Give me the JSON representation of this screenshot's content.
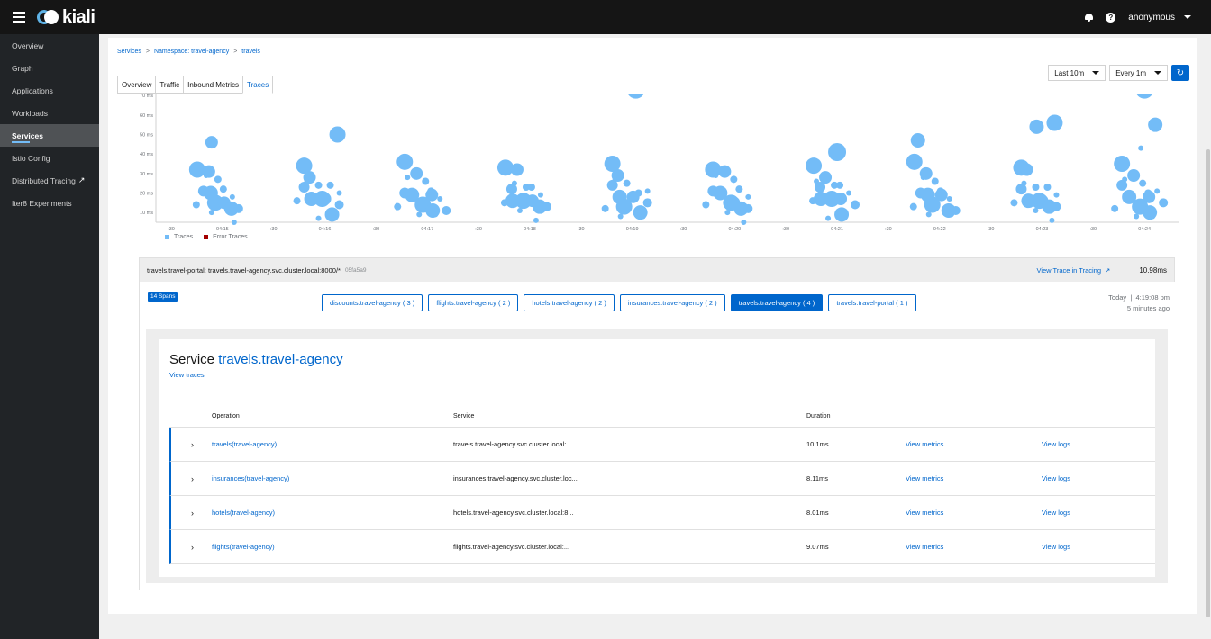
{
  "header": {
    "brand": "kiali",
    "user": "anonymous"
  },
  "sidebar": {
    "items": [
      {
        "label": "Overview"
      },
      {
        "label": "Graph"
      },
      {
        "label": "Applications"
      },
      {
        "label": "Workloads"
      },
      {
        "label": "Services",
        "active": true
      },
      {
        "label": "Istio Config"
      },
      {
        "label": "Distributed Tracing"
      },
      {
        "label": "Iter8 Experiments"
      }
    ]
  },
  "breadcrumb": {
    "services": "Services",
    "namespace": "Namespace: travel-agency",
    "service": "travels"
  },
  "time_controls": {
    "duration": "Last 10m",
    "refresh": "Every 1m"
  },
  "tabs": [
    "Overview",
    "Traffic",
    "Inbound Metrics",
    "Traces"
  ],
  "chart_data": {
    "type": "scatter",
    "y_ticks": [
      "70 ms",
      "60 ms",
      "50 ms",
      "40 ms",
      "30 ms",
      "20 ms",
      "10 ms"
    ],
    "ylim": [
      5,
      71
    ],
    "x_ticks": [
      ":30",
      "04:15",
      ":30",
      "04:16",
      ":30",
      "04:17",
      ":30",
      "04:18",
      ":30",
      "04:19",
      ":30",
      "04:20",
      ":30",
      "04:21",
      ":30",
      "04:22",
      ":30",
      "04:23",
      ":30",
      "04:24"
    ],
    "legend": [
      {
        "name": "Traces",
        "color": "#73bcf7"
      },
      {
        "name": "Error Traces",
        "color": "#a30000"
      }
    ]
  },
  "trace": {
    "title": "travels.travel-portal: travels.travel-agency.svc.cluster.local:8000/*",
    "id": "05fa5a9",
    "view_in_tracing": "View Trace in Tracing",
    "duration": "10.98ms",
    "spans_badge": "14 Spans",
    "date": "Today",
    "time": "4:19:08 pm",
    "ago": "5 minutes ago",
    "span_buttons": [
      {
        "label": "discounts.travel-agency ( 3 )"
      },
      {
        "label": "flights.travel-agency ( 2 )"
      },
      {
        "label": "hotels.travel-agency ( 2 )"
      },
      {
        "label": "insurances.travel-agency ( 2 )"
      },
      {
        "label": "travels.travel-agency ( 4 )",
        "active": true
      },
      {
        "label": "travels.travel-portal ( 1 )"
      }
    ]
  },
  "service_panel": {
    "title_prefix": "Service",
    "service_name": "travels.travel-agency",
    "view_traces": "View traces",
    "headers": {
      "operation": "Operation",
      "service": "Service",
      "duration": "Duration"
    },
    "rows": [
      {
        "operation": "travels(travel-agency)",
        "service": "travels.travel-agency.svc.cluster.local:...",
        "duration": "10.1ms",
        "metrics": "View metrics",
        "logs": "View logs"
      },
      {
        "operation": "insurances(travel-agency)",
        "service": "insurances.travel-agency.svc.cluster.loc...",
        "duration": "8.11ms",
        "metrics": "View metrics",
        "logs": "View logs"
      },
      {
        "operation": "hotels(travel-agency)",
        "service": "hotels.travel-agency.svc.cluster.local:8...",
        "duration": "8.01ms",
        "metrics": "View metrics",
        "logs": "View logs"
      },
      {
        "operation": "flights(travel-agency)",
        "service": "flights.travel-agency.svc.cluster.local:...",
        "duration": "9.07ms",
        "metrics": "View metrics",
        "logs": "View logs"
      }
    ]
  }
}
